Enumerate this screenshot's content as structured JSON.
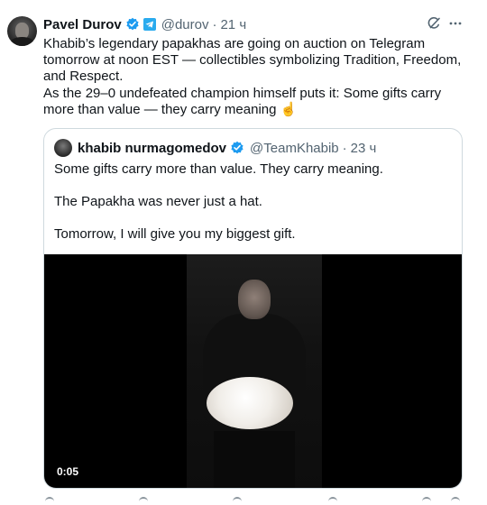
{
  "author": {
    "name": "Pavel Durov",
    "handle": "@durov",
    "separator": "·",
    "time": "21 ч"
  },
  "tweet": {
    "paragraph1": "Khabib’s legendary papakhas are going on auction on Telegram tomorrow at noon EST — collectibles symbolizing Tradition, Freedom, and Respect.",
    "paragraph2": "As the 29–0 undefeated champion himself puts it: Some gifts carry more than value — they carry meaning ☝️"
  },
  "quoted": {
    "name": "khabib nurmagomedov",
    "handle": "@TeamKhabib",
    "separator": "·",
    "time": "23 ч",
    "line1": "Some gifts carry more than value. They carry meaning.",
    "line2": "The Papakha was never just a hat.",
    "line3": "Tomorrow, I will give you my biggest gift.",
    "video_timecode": "0:05"
  },
  "icons": {
    "verified": "verified-badge-icon",
    "telegram": "telegram-affiliate-icon",
    "grok": "grok-icon",
    "more": "more-icon"
  },
  "colors": {
    "verified_blue": "#1d9bf0",
    "secondary_text": "#536471",
    "border": "#cfd9de"
  }
}
